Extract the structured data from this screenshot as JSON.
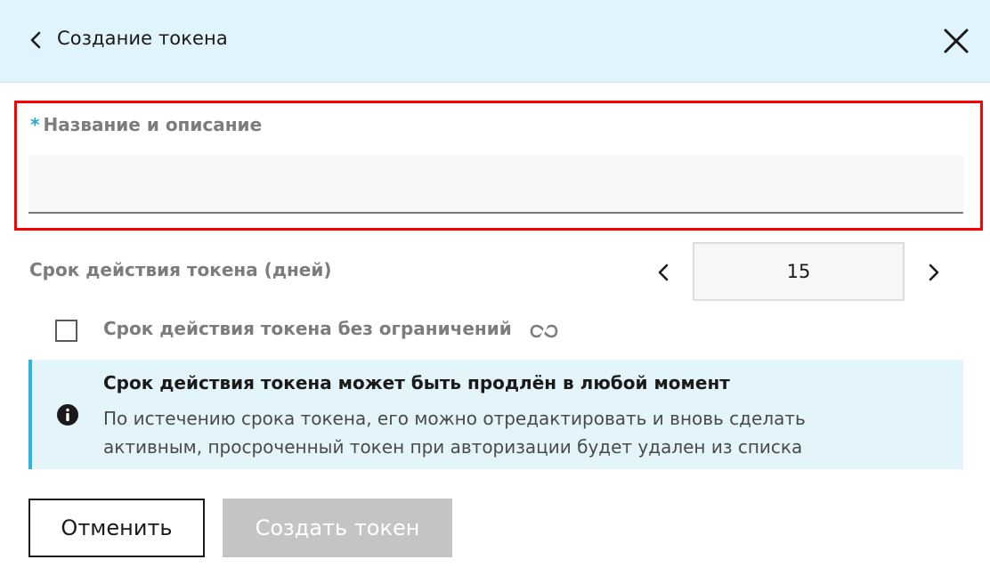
{
  "header": {
    "title": "Создание токена",
    "back_icon": "chevron-left-icon",
    "close_icon": "close-icon"
  },
  "name_field": {
    "required_mark": "*",
    "label": "Название и описание",
    "value": "",
    "placeholder": ""
  },
  "term": {
    "label": "Срок действия токена (дней)",
    "value": "15",
    "decrement_icon": "chevron-left-icon",
    "increment_icon": "chevron-right-icon"
  },
  "unlimited": {
    "label": "Срок действия токена без ограничений",
    "checked": false,
    "icon": "infinity-icon"
  },
  "info": {
    "icon": "info-icon",
    "title": "Срок действия токена может быть продлён в любой момент",
    "text": "По истечению срока токена, его можно отредактировать и вновь сделать активным, просроченный токен при авторизации будет удален из списка"
  },
  "buttons": {
    "cancel": "Отменить",
    "create": "Создать токен"
  },
  "colors": {
    "header_bg": "#dff4fc",
    "accent": "#29a6cf",
    "highlight_border": "#ff0000",
    "info_bg": "#e3f5fb",
    "disabled_button": "#c4c4c4"
  }
}
